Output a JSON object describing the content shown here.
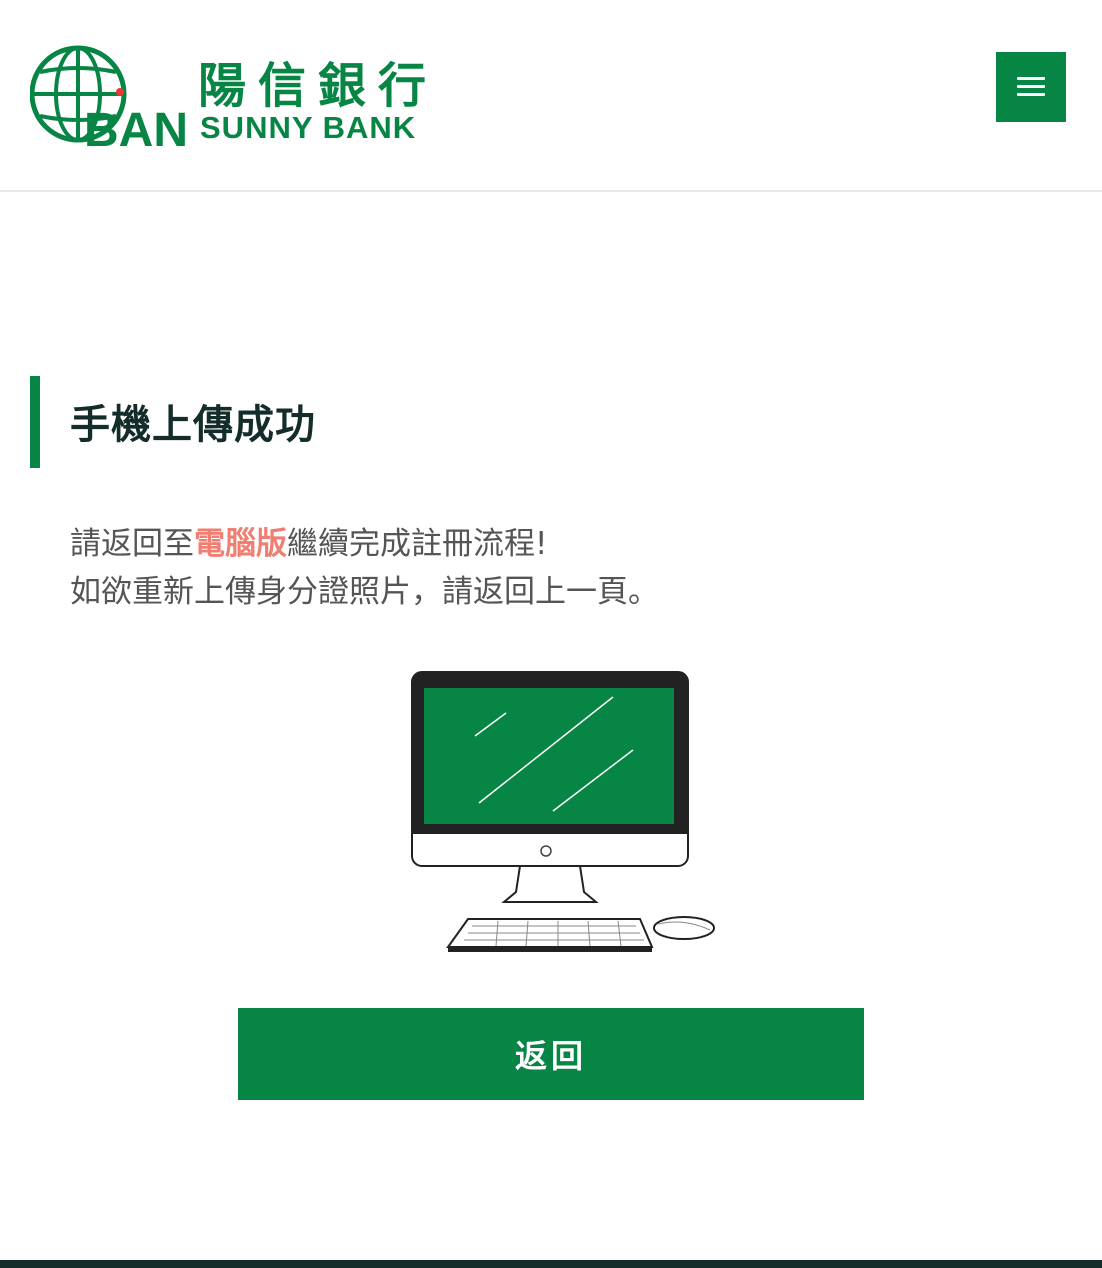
{
  "header": {
    "brand_cn": "陽信銀行",
    "brand_en": "SUNNY BANK",
    "logo_icon": "sunny-bank-globe-logo",
    "menu_icon": "hamburger-menu-icon"
  },
  "main": {
    "title": "手機上傳成功",
    "message_line1_prefix": "請返回至",
    "message_line1_highlight": "電腦版",
    "message_line1_suffix": "繼續完成註冊流程!",
    "message_line2": "如欲重新上傳身分證照片，請返回上一頁。",
    "illustration": "desktop-computer-illustration",
    "back_button_label": "返回"
  },
  "colors": {
    "brand_green": "#078544",
    "highlight": "#f07f73",
    "title_text": "#142d2a",
    "body_text": "#555555",
    "footer": "#142d2a"
  }
}
